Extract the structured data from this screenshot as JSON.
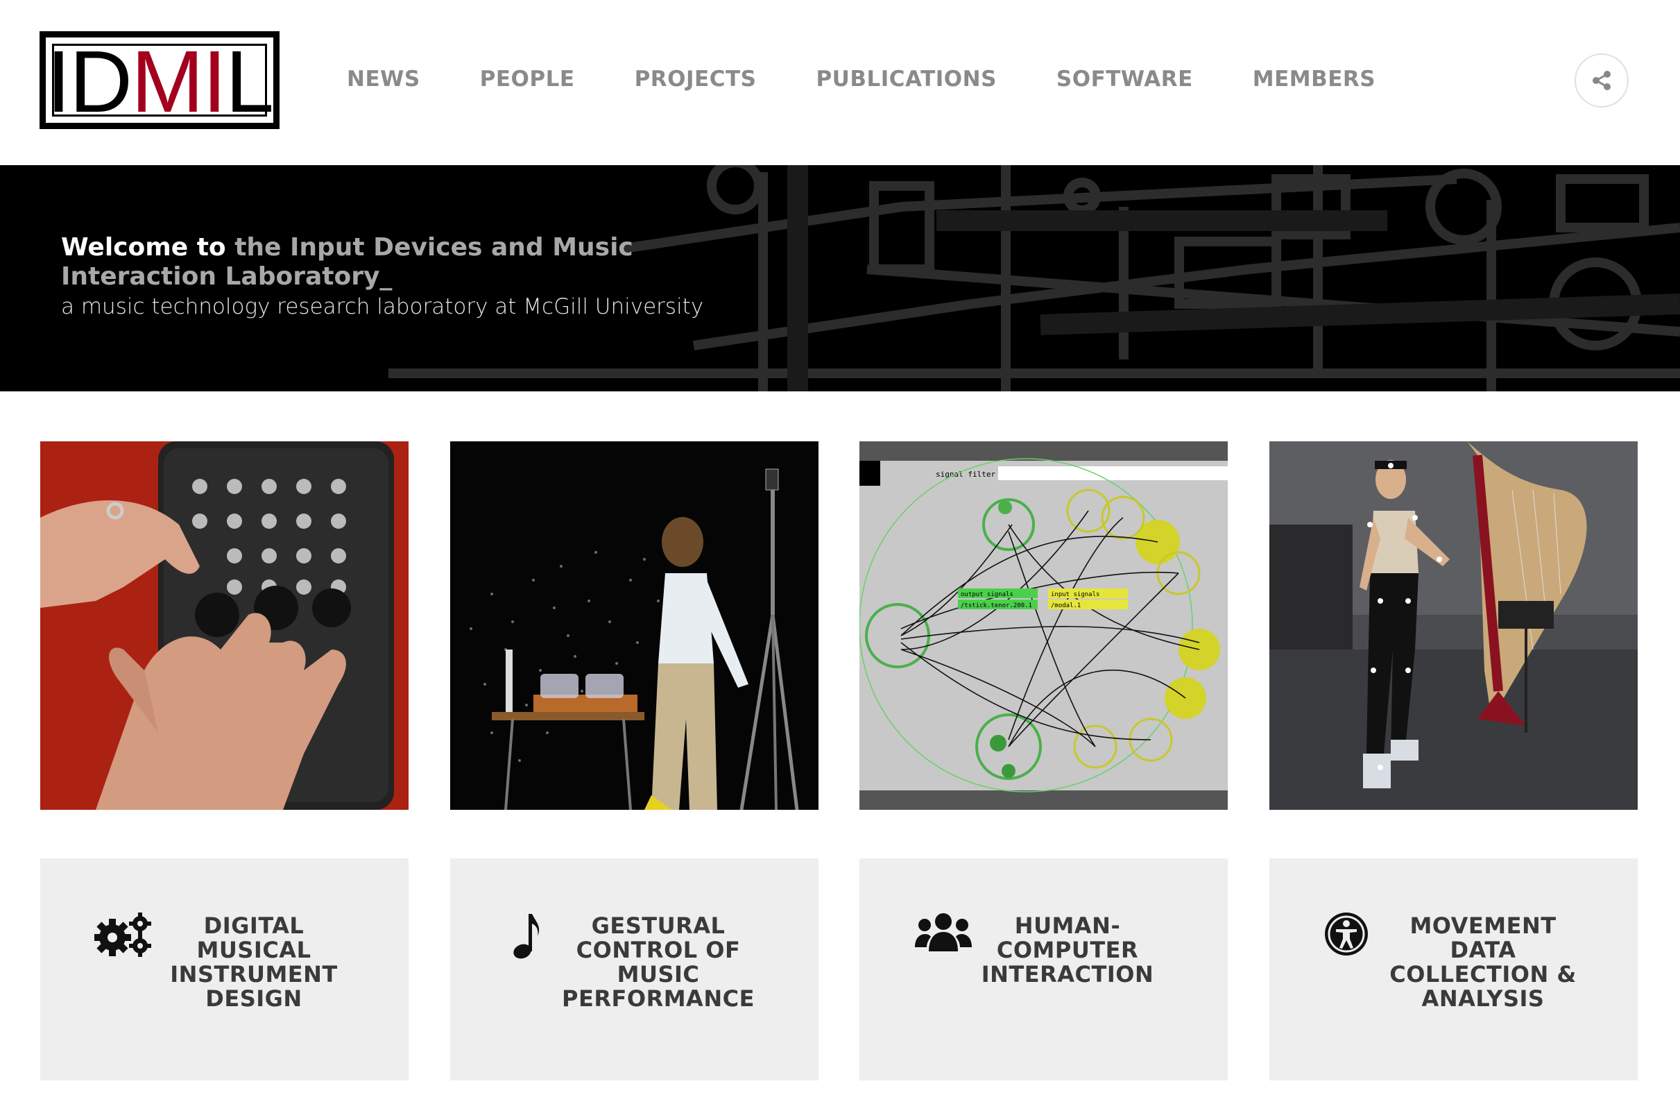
{
  "logo": {
    "part1": "ID",
    "part2": "MI",
    "part3": "L"
  },
  "nav": [
    "NEWS",
    "PEOPLE",
    "PROJECTS",
    "PUBLICATIONS",
    "SOFTWARE",
    "MEMBERS"
  ],
  "hero": {
    "welcome": "Welcome to",
    "title": " the Input Devices and Music Interaction Laboratory_",
    "subtitle": "a music technology research laboratory at McGill University"
  },
  "patch": {
    "window_title": "signal filter",
    "output_label": "output signals",
    "output_value": "/tstick.tenor.200.1",
    "input_label": "input signals",
    "input_value": "/modal.1"
  },
  "categories": [
    {
      "label": "DIGITAL MUSICAL INSTRUMENT DESIGN",
      "icon": "gears-icon"
    },
    {
      "label": "GESTURAL CONTROL OF MUSIC PERFORMANCE",
      "icon": "music-note-icon"
    },
    {
      "label": "HUMAN-COMPUTER INTERACTION",
      "icon": "users-icon"
    },
    {
      "label": "MOVEMENT DATA COLLECTION & ANALYSIS",
      "icon": "accessibility-icon"
    }
  ],
  "colors": {
    "logo_red": "#a3001e",
    "nav_grey": "#8a8a8a",
    "card_bg": "#eeeeee",
    "hero_bg": "#000000"
  }
}
